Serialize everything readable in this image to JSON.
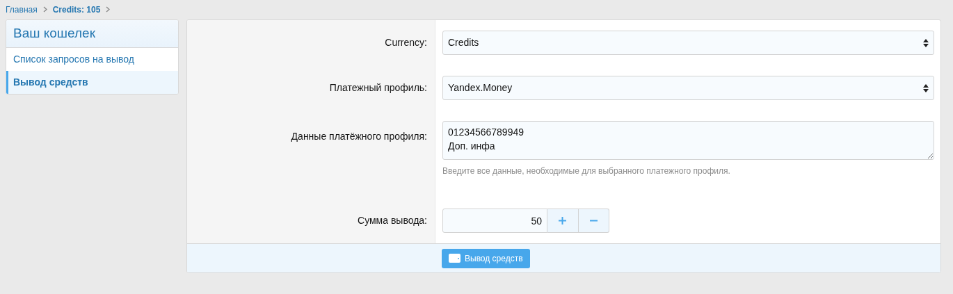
{
  "breadcrumbs": [
    {
      "label": "Главная",
      "current": false
    },
    {
      "label": "Credits: 105",
      "current": true
    }
  ],
  "sidebar": {
    "title": "Ваш кошелек",
    "items": [
      {
        "label": "Список запросов на вывод",
        "selected": false
      },
      {
        "label": "Вывод средств",
        "selected": true
      }
    ]
  },
  "form": {
    "fields": [
      {
        "kind": "select",
        "label": "Currency:",
        "value": "Credits"
      },
      {
        "kind": "select",
        "label": "Платежный профиль:",
        "value": "Yandex.Money"
      },
      {
        "kind": "textarea",
        "label": "Данные платёжного профиля:",
        "value": "01234566789949\nДоп. инфа",
        "hint": "Введите все данные, необходимые для выбранного платежного профиля."
      },
      {
        "kind": "number",
        "label": "Сумма вывода:",
        "value": "50"
      }
    ],
    "submit": "Вывод средств"
  }
}
